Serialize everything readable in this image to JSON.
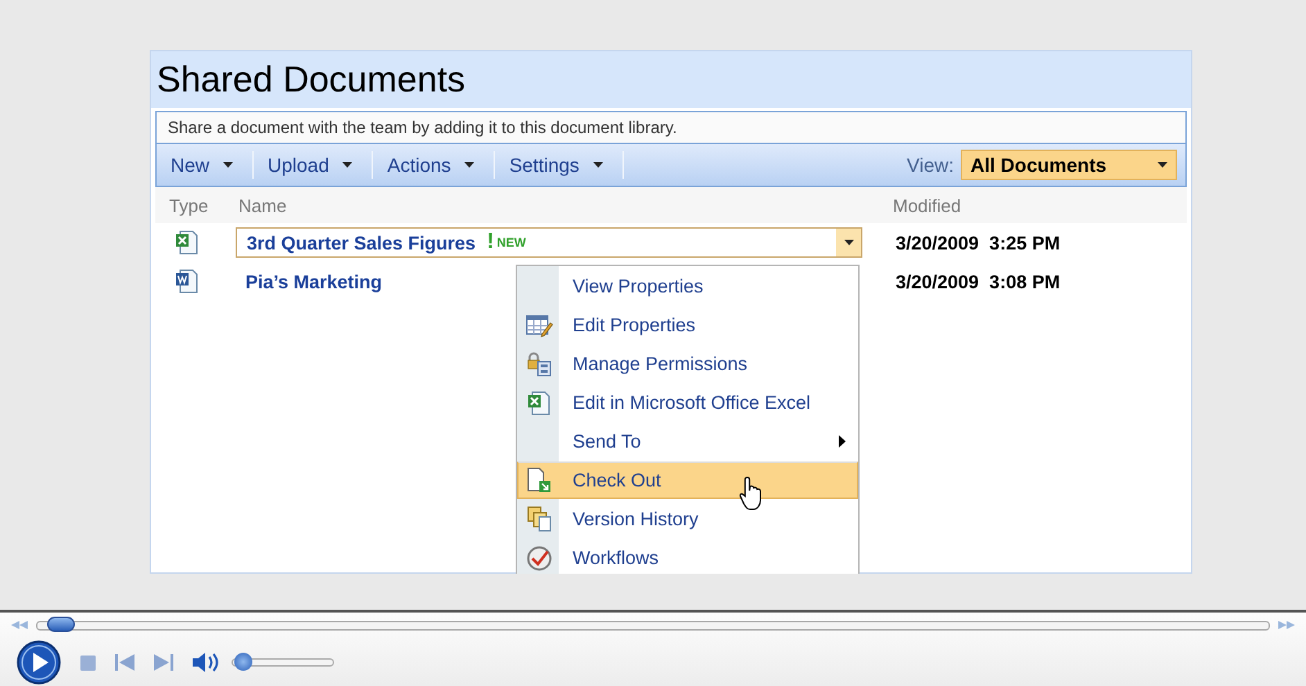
{
  "library": {
    "title": "Shared Documents",
    "description": "Share a document with the team by adding it to this document library.",
    "toolbar": [
      {
        "label": "New"
      },
      {
        "label": "Upload"
      },
      {
        "label": "Actions"
      },
      {
        "label": "Settings"
      }
    ],
    "view": {
      "label": "View:",
      "value": "All Documents"
    },
    "columns": [
      "Type",
      "Name",
      "Modified"
    ],
    "rows": [
      {
        "kind": "excel",
        "name": "3rd Quarter Sales Figures",
        "new_mark": "!",
        "new_badge": "NEW",
        "modified": "3/20/2009  3:25 PM",
        "selected": true
      },
      {
        "kind": "word",
        "name": "Pia’s Marketing",
        "modified": "3/20/2009  3:08 PM",
        "selected": false
      }
    ],
    "menu": [
      {
        "kind": "plain",
        "label": "View Properties",
        "selected": false,
        "submenu": false
      },
      {
        "kind": "edit",
        "label": "Edit Properties",
        "selected": false,
        "submenu": false
      },
      {
        "kind": "permissions",
        "label": "Manage Permissions",
        "selected": false,
        "submenu": false
      },
      {
        "kind": "excel",
        "label": "Edit in Microsoft Office Excel",
        "selected": false,
        "submenu": false
      },
      {
        "kind": "plain",
        "label": "Send To",
        "selected": false,
        "submenu": true
      },
      {
        "kind": "checkout",
        "label": "Check Out",
        "selected": true,
        "submenu": false
      },
      {
        "kind": "history",
        "label": "Version History",
        "selected": false,
        "submenu": false
      },
      {
        "kind": "workflow",
        "label": "Workflows",
        "selected": false,
        "submenu": false
      }
    ]
  },
  "player": {
    "seek": {
      "level": 0.01
    },
    "volume": {
      "level": 0.1
    }
  }
}
